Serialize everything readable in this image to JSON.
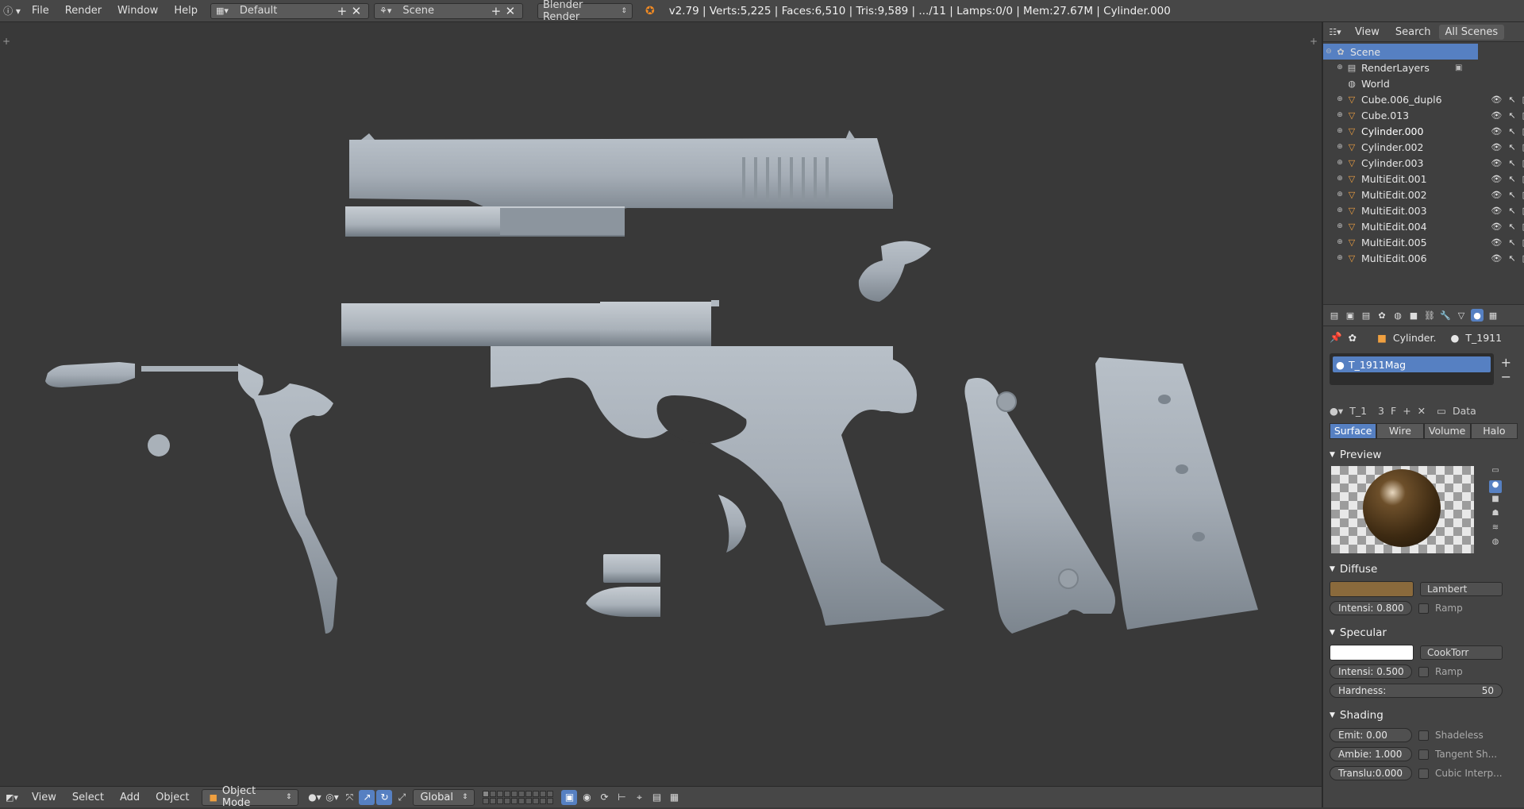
{
  "topbar": {
    "menu": [
      "File",
      "Render",
      "Window",
      "Help"
    ],
    "layout_name": "Default",
    "scene_name": "Scene",
    "engine": "Blender Render",
    "info": "v2.79 | Verts:5,225 | Faces:6,510 | Tris:9,589 | .../11 | Lamps:0/0 | Mem:27.67M | Cylinder.000"
  },
  "bottombar": {
    "menu": [
      "View",
      "Select",
      "Add",
      "Object"
    ],
    "mode": "Object Mode",
    "orientation": "Global"
  },
  "outliner": {
    "header": [
      "View",
      "Search",
      "All Scenes"
    ],
    "scene": "Scene",
    "items": [
      {
        "label": "RenderLayers",
        "type": "renderlayers"
      },
      {
        "label": "World",
        "type": "world"
      },
      {
        "label": "Cube.006_dupl6",
        "type": "mesh"
      },
      {
        "label": "Cube.013",
        "type": "mesh"
      },
      {
        "label": "Cylinder.000",
        "type": "mesh"
      },
      {
        "label": "Cylinder.002",
        "type": "mesh"
      },
      {
        "label": "Cylinder.003",
        "type": "mesh"
      },
      {
        "label": "MultiEdit.001",
        "type": "mesh"
      },
      {
        "label": "MultiEdit.002",
        "type": "mesh"
      },
      {
        "label": "MultiEdit.003",
        "type": "mesh"
      },
      {
        "label": "MultiEdit.004",
        "type": "mesh"
      },
      {
        "label": "MultiEdit.005",
        "type": "mesh"
      },
      {
        "label": "MultiEdit.006",
        "type": "mesh"
      }
    ]
  },
  "properties": {
    "path_object": "Cylinder.",
    "path_material": "T_1911",
    "slot_name": "T_1911Mag",
    "material_field": "T_1",
    "users": "3",
    "fake_user": "F",
    "link": "Data",
    "tabs": [
      "Surface",
      "Wire",
      "Volume",
      "Halo"
    ],
    "preview_title": "Preview",
    "diffuse": {
      "title": "Diffuse",
      "color": "#8a6a3c",
      "shader": "Lambert",
      "intensity": "Intensi: 0.800",
      "ramp": "Ramp"
    },
    "specular": {
      "title": "Specular",
      "color": "#ffffff",
      "shader": "CookTorr",
      "intensity": "Intensi: 0.500",
      "ramp": "Ramp",
      "hardness_label": "Hardness:",
      "hardness_value": "50"
    },
    "shading": {
      "title": "Shading",
      "emit": "Emit:       0.00",
      "ambient": "Ambie: 1.000",
      "translucency": "Translu:0.000",
      "shadeless": "Shadeless",
      "tangent": "Tangent Sh...",
      "cubic": "Cubic Interp..."
    }
  }
}
